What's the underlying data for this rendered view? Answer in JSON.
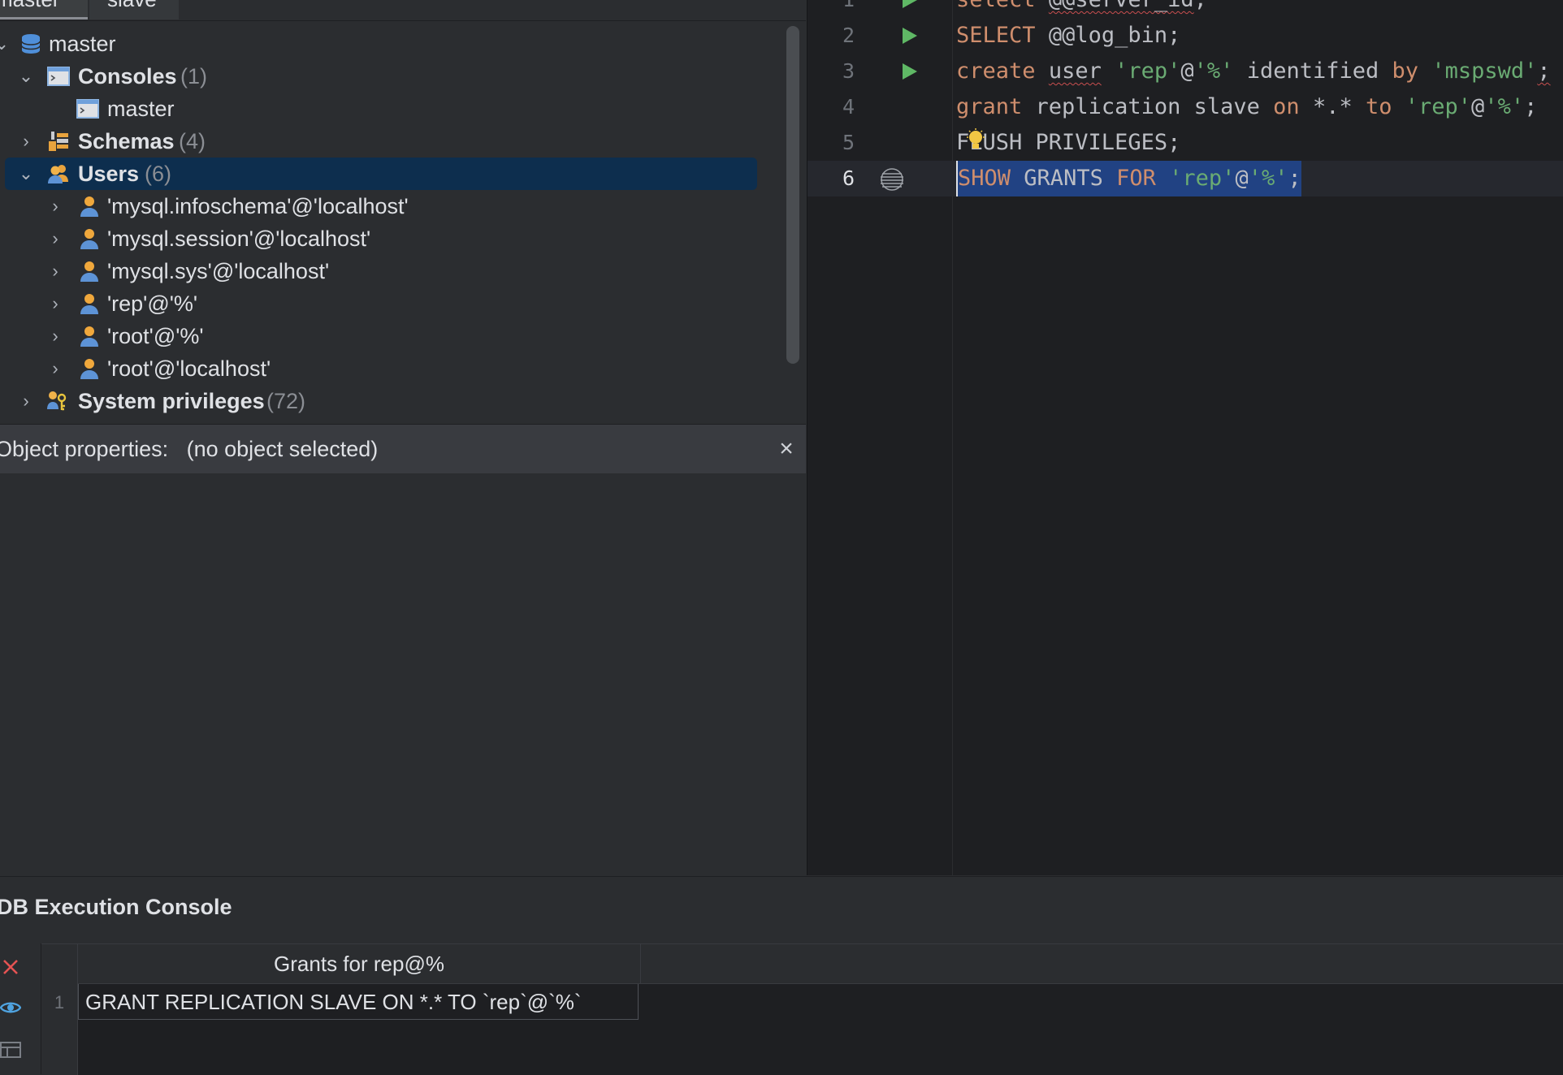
{
  "tabs": [
    {
      "label": "master",
      "active": true
    },
    {
      "label": "slave",
      "active": false
    }
  ],
  "tree": {
    "root": {
      "label": "master"
    },
    "consoles": {
      "label": "Consoles",
      "count": "(1)",
      "child": "master"
    },
    "schemas": {
      "label": "Schemas",
      "count": "(4)"
    },
    "users": {
      "label": "Users",
      "count": "(6)",
      "items": [
        "'mysql.infoschema'@'localhost'",
        "'mysql.session'@'localhost'",
        "'mysql.sys'@'localhost'",
        "'rep'@'%'",
        "'root'@'%'",
        "'root'@'localhost'"
      ]
    },
    "system_privileges": {
      "label": "System privileges",
      "count": "(72)"
    }
  },
  "object_properties": {
    "label": "Object properties:",
    "value": "(no object selected)"
  },
  "editor": {
    "lines": [
      {
        "num": "1",
        "text": "select @@server_id;"
      },
      {
        "num": "2",
        "text": "SELECT @@log_bin;"
      },
      {
        "num": "3",
        "text": "create user 'rep'@'%' identified by 'mspswd';"
      },
      {
        "num": "4",
        "text": "grant replication slave on *.* to 'rep'@'%';"
      },
      {
        "num": "5",
        "text": "FLUSH PRIVILEGES;"
      },
      {
        "num": "6",
        "text": "SHOW GRANTS FOR 'rep'@'%';"
      }
    ],
    "current_line": 6,
    "colors": {
      "keyword": "#cf8e6d",
      "string": "#6aab73",
      "plain": "#bcbec4",
      "selection": "#214283"
    }
  },
  "console": {
    "title": "DB Execution Console",
    "column_header": "Grants for rep@%",
    "rows": [
      {
        "num": "1",
        "value": "GRANT REPLICATION SLAVE ON *.* TO `rep`@`%`"
      }
    ]
  },
  "icons": {
    "close": "close-icon",
    "run": "run-line-icon",
    "stop": "stop-icon",
    "view": "eye-icon",
    "layout": "table-view-icon",
    "intention": "lightbulb-icon"
  }
}
